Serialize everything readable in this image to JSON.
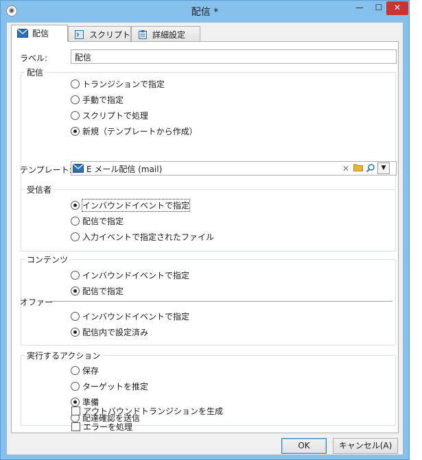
{
  "window": {
    "title": "配信 *",
    "accent": "#86c1ee"
  },
  "titlebar": {
    "minimize": "—",
    "maximize": "☐",
    "close": "✕"
  },
  "tabs": [
    {
      "label": "配信",
      "icon": "mail-icon",
      "active": true
    },
    {
      "label": "スクリプト",
      "icon": "script-icon",
      "active": false
    },
    {
      "label": "詳細設定",
      "icon": "clipboard-icon",
      "active": false
    }
  ],
  "label_field": {
    "label": "ラベル:",
    "value": "配信"
  },
  "delivery_group": {
    "title": "配信",
    "options": [
      {
        "label": "トランジションで指定",
        "checked": false
      },
      {
        "label": "手動で指定",
        "checked": false
      },
      {
        "label": "スクリプトで処理",
        "checked": false
      },
      {
        "label": "新規（テンプレートから作成）",
        "checked": true
      }
    ],
    "template_label": "テンプレート:",
    "template_value": "E メール配信 (mail)"
  },
  "recipients_group": {
    "title": "受信者",
    "options": [
      {
        "label": "インバウンドイベントで指定",
        "checked": true
      },
      {
        "label": "配信で指定",
        "checked": false
      },
      {
        "label": "入力イベントで指定されたファイル",
        "checked": false
      }
    ]
  },
  "content_group": {
    "title": "コンテンツ",
    "options": [
      {
        "label": "インバウンドイベントで指定",
        "checked": false
      },
      {
        "label": "配信で指定",
        "checked": true
      }
    ],
    "offer_title": "オファー",
    "offer_options": [
      {
        "label": "インバウンドイベントで指定",
        "checked": false
      },
      {
        "label": "配信内で設定済み",
        "checked": true
      }
    ]
  },
  "action_group": {
    "title": "実行するアクション",
    "options": [
      {
        "label": "保存",
        "checked": false
      },
      {
        "label": "ターゲットを推定",
        "checked": false
      },
      {
        "label": "準備",
        "checked": true
      },
      {
        "label": "配達確認を送信",
        "checked": false
      }
    ]
  },
  "checkboxes": [
    {
      "label": "アウトバウンドトランジションを生成",
      "checked": false
    },
    {
      "label": "エラーを処理",
      "checked": false
    }
  ],
  "buttons": {
    "ok": "OK",
    "cancel": "キャンセル(A)"
  }
}
